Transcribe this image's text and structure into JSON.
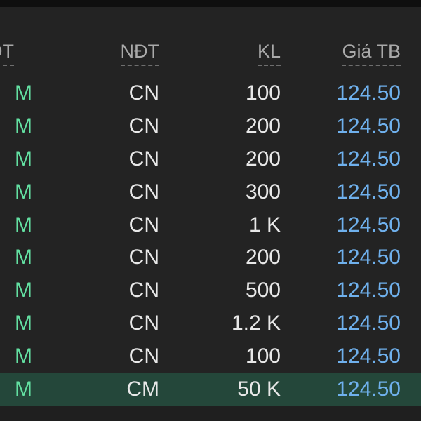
{
  "table": {
    "headers": {
      "lenh": "ĐT",
      "ndt": "NĐT",
      "kl": "KL",
      "gia_tb": "Giá TB"
    },
    "rows": [
      {
        "side": "M",
        "ndt": "CN",
        "kl": "100",
        "gia": "124.50"
      },
      {
        "side": "M",
        "ndt": "CN",
        "kl": "200",
        "gia": "124.50"
      },
      {
        "side": "M",
        "ndt": "CN",
        "kl": "200",
        "gia": "124.50"
      },
      {
        "side": "M",
        "ndt": "CN",
        "kl": "300",
        "gia": "124.50"
      },
      {
        "side": "M",
        "ndt": "CN",
        "kl": "1 K",
        "gia": "124.50"
      },
      {
        "side": "M",
        "ndt": "CN",
        "kl": "200",
        "gia": "124.50"
      },
      {
        "side": "M",
        "ndt": "CN",
        "kl": "500",
        "gia": "124.50"
      },
      {
        "side": "M",
        "ndt": "CN",
        "kl": "1.2 K",
        "gia": "124.50"
      },
      {
        "side": "M",
        "ndt": "CN",
        "kl": "100",
        "gia": "124.50"
      },
      {
        "side": "M",
        "ndt": "CM",
        "kl": "50 K",
        "gia": "124.50"
      }
    ]
  },
  "colors": {
    "background": "#232323",
    "buy_side": "#63e0a2",
    "price": "#6fb0ec",
    "highlight_row": "#24473a",
    "header_text": "#a9a9a9"
  }
}
